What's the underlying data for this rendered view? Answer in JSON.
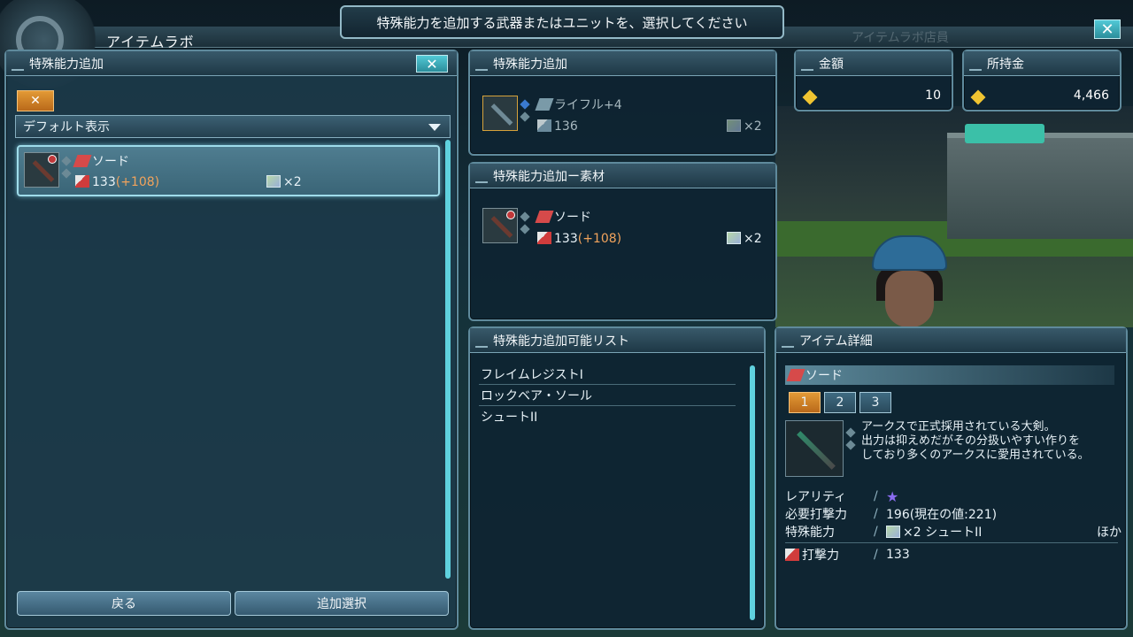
{
  "header": {
    "app_title": "アイテムラボ",
    "prompt": "特殊能力を追加する武器またはユニットを、選択してください",
    "ghost_label": "アイテムラボ店員",
    "close_icon": "✕"
  },
  "left_panel": {
    "title": "特殊能力追加",
    "category_icon": "✕",
    "filter_value": "デフォルト表示",
    "items": [
      {
        "name": "ソード",
        "atk": "133",
        "atk_bonus": "(+108)",
        "slots": "×2"
      }
    ],
    "back_label": "戻る",
    "add_label": "追加選択"
  },
  "base_panel": {
    "title": "特殊能力追加",
    "item_name": "ライフル+4",
    "atk": "136",
    "slots": "×2"
  },
  "material_panel": {
    "title": "特殊能力追加ー素材",
    "item_name": "ソード",
    "atk": "133",
    "atk_bonus": "(+108)",
    "slots": "×2"
  },
  "money": {
    "cost_label": "金額",
    "cost_value": "10",
    "owned_label": "所持金",
    "owned_value": "4,466"
  },
  "ability_list": {
    "title": "特殊能力追加可能リスト",
    "rows": [
      "フレイムレジストI",
      "ロックベア・ソール",
      "シュートII"
    ]
  },
  "detail": {
    "title": "アイテム詳細",
    "name": "ソード",
    "tabs": [
      "1",
      "2",
      "3"
    ],
    "description": "アークスで正式採用されている大剣。\n出力は抑えめだがその分扱いやすい作りを\nしており多くのアークスに愛用されている。",
    "rarity_label": "レアリティ",
    "rarity_star": "★",
    "required_label": "必要打撃力",
    "required_value": "196(現在の値:221)",
    "ability_label": "特殊能力",
    "ability_value": "×2 シュートII",
    "ability_more": "ほか",
    "atk_label": "打撃力",
    "atk_value": "133"
  },
  "colors": {
    "accent_cyan": "#5fd1de",
    "tab_orange": "#e39a36",
    "bonus_orange": "#f1a35c",
    "gold": "#f0c431"
  }
}
